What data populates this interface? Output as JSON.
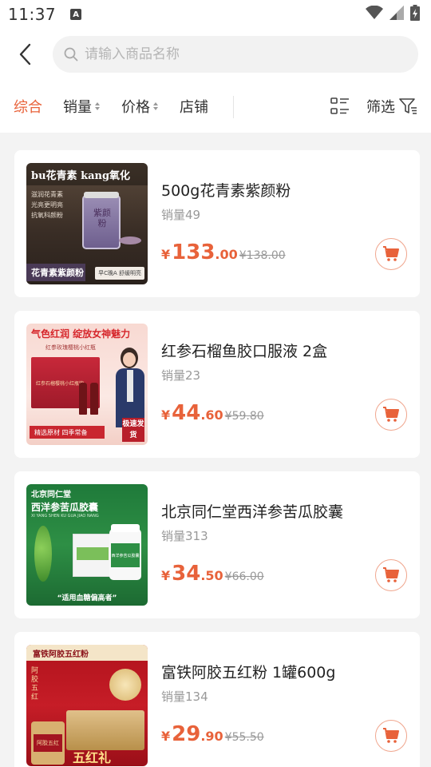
{
  "status_bar": {
    "time": "11:37",
    "notification_letter": "A"
  },
  "header": {
    "search": {
      "placeholder": "请输入商品名称",
      "value": ""
    }
  },
  "filters": {
    "comprehensive": "综合",
    "sales": "销量",
    "price": "价格",
    "store": "店铺",
    "screen": "筛选",
    "active_color": "#e8623a"
  },
  "products": [
    {
      "name": "500g花青素紫颜粉",
      "sales": "销量49",
      "currency": "¥",
      "price_int": "133",
      "price_dec": ".00",
      "original_price": "¥138.00",
      "image": {
        "top_banner": "bu花青素 kang氧化",
        "bullets": [
          "滋润花青素",
          "光亮更明亮",
          "抗氧科颜粉"
        ],
        "jar_label": "紫颜粉",
        "bottom_left": "花青素紫颜粉",
        "bottom_right": "早C晚A 舒缓明亮"
      }
    },
    {
      "name": "红参石榴鱼胶口服液 2盒",
      "sales": "销量23",
      "currency": "¥",
      "price_int": "44",
      "price_dec": ".60",
      "original_price": "¥59.80",
      "image": {
        "top_banner": "气色红润 绽放女神魅力",
        "sub_banner": "红参玫瑰樱桃小红瓶",
        "box_label": "红参石榴樱桃小红瓶饮",
        "bottom_left": "精选原材 四季常备",
        "bottom_right": "极速发货"
      }
    },
    {
      "name": "北京同仁堂西洋参苦瓜胶囊",
      "sales": "销量313",
      "currency": "¥",
      "price_int": "34",
      "price_dec": ".50",
      "original_price": "¥66.00",
      "image": {
        "brand": "北京同仁堂",
        "title": "西洋参苦瓜胶囊",
        "pinyin": "XI YANG SHEN KU GUA JIAO NANG",
        "bottle_label": "西洋参苦瓜胶囊",
        "bottom": "“适用血糖偏高者”"
      }
    },
    {
      "name": "富铁阿胶五红粉 1罐600g",
      "sales": "销量134",
      "currency": "¥",
      "price_int": "29",
      "price_dec": ".90",
      "original_price": "¥55.50",
      "image": {
        "top_banner": "富铁阿胶五红粉",
        "side_tag": "阿胶五红",
        "jar_label": "阿胶五红",
        "gift_text": "五红礼"
      }
    }
  ],
  "colors": {
    "accent": "#e8623a",
    "cart_border": "#f0a68e"
  }
}
